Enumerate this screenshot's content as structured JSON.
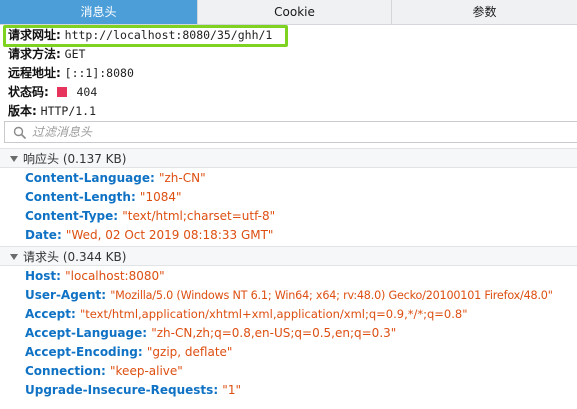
{
  "tabs": [
    {
      "label": "消息头",
      "selected": true
    },
    {
      "label": "Cookie",
      "selected": false
    },
    {
      "label": "参数",
      "selected": false
    }
  ],
  "summary": {
    "url_label": "请求网址:",
    "url_value": "http://localhost:8080/35/ghh/1",
    "method_label": "请求方法:",
    "method_value": "GET",
    "remote_label": "远程地址:",
    "remote_value": "[::1]:8080",
    "status_label": "状态码:",
    "status_value": "404",
    "status_color": "#e7345c",
    "version_label": "版本:",
    "version_value": "HTTP/1.1"
  },
  "filter": {
    "placeholder": "过滤消息头",
    "icon": "search-icon"
  },
  "response_section": {
    "title": "响应头 (0.137 KB)",
    "headers": [
      {
        "name": "Content-Language",
        "value": "\"zh-CN\""
      },
      {
        "name": "Content-Length",
        "value": "\"1084\""
      },
      {
        "name": "Content-Type",
        "value": "\"text/html;charset=utf-8\""
      },
      {
        "name": "Date",
        "value": "\"Wed, 02 Oct 2019 08:18:33 GMT\""
      }
    ]
  },
  "request_section": {
    "title": "请求头 (0.344 KB)",
    "headers": [
      {
        "name": "Host",
        "value": "\"localhost:8080\""
      },
      {
        "name": "User-Agent",
        "value": "\"Mozilla/5.0 (Windows NT 6.1; Win64; x64; rv:48.0) Gecko/20100101 Firefox/48.0\""
      },
      {
        "name": "Accept",
        "value": "\"text/html,application/xhtml+xml,application/xml;q=0.9,*/*;q=0.8\""
      },
      {
        "name": "Accept-Language",
        "value": "\"zh-CN,zh;q=0.8,en-US;q=0.5,en;q=0.3\""
      },
      {
        "name": "Accept-Encoding",
        "value": "\"gzip, deflate\""
      },
      {
        "name": "Connection",
        "value": "\"keep-alive\""
      },
      {
        "name": "Upgrade-Insecure-Requests",
        "value": "\"1\""
      }
    ]
  },
  "colors": {
    "selected_tab": "#4c9ed9",
    "header_name": "#0f72c4",
    "header_value": "#dd4f11",
    "highlight_box": "#7ed321"
  }
}
